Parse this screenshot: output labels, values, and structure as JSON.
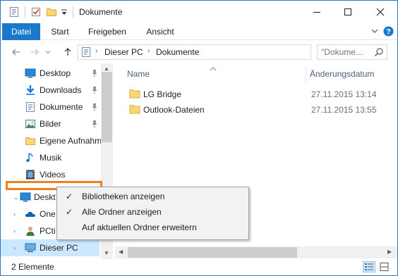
{
  "window": {
    "title": "Dokumente",
    "controls": [
      "minimize",
      "maximize",
      "close"
    ]
  },
  "quick_access_toolbar": {
    "icons": [
      "properties-icon",
      "checkmark-icon",
      "new-folder-icon",
      "customize-dropdown-icon"
    ]
  },
  "ribbon": {
    "tabs": [
      {
        "label": "Datei",
        "active": true
      },
      {
        "label": "Start"
      },
      {
        "label": "Freigeben"
      },
      {
        "label": "Ansicht"
      }
    ],
    "expand_icon": "chevron-down-icon",
    "help_icon": "help-icon",
    "accent": "#1979ca"
  },
  "address_bar": {
    "segments": [
      "Dieser PC",
      "Dokumente"
    ],
    "search_placeholder": "\"Dokume..."
  },
  "nav_pane": {
    "items": [
      {
        "label": "Desktop",
        "icon": "desktop-icon",
        "pinned": true
      },
      {
        "label": "Downloads",
        "icon": "downloads-icon",
        "pinned": true
      },
      {
        "label": "Dokumente",
        "icon": "documents-icon",
        "pinned": true
      },
      {
        "label": "Bilder",
        "icon": "pictures-icon",
        "pinned": true
      },
      {
        "label": "Eigene Aufnahm",
        "icon": "folder-icon",
        "pinned": false
      },
      {
        "label": "Musik",
        "icon": "music-icon",
        "pinned": false
      },
      {
        "label": "Videos",
        "icon": "videos-icon",
        "pinned": false
      },
      {
        "label": "Deskt",
        "icon": "desktop-icon",
        "expanded": true
      },
      {
        "label": "One",
        "icon": "onedrive-icon"
      },
      {
        "label": "PCti",
        "icon": "user-icon"
      },
      {
        "label": "Dieser PC",
        "icon": "computer-icon",
        "selected": true
      }
    ]
  },
  "file_list": {
    "columns": {
      "name": "Name",
      "modified": "Änderungsdatum"
    },
    "rows": [
      {
        "name": "LG Bridge",
        "modified": "27.11.2015 13:14"
      },
      {
        "name": "Outlook-Dateien",
        "modified": "27.11.2015 13:55"
      }
    ]
  },
  "context_menu": {
    "items": [
      {
        "label": "Bibliotheken anzeigen",
        "checked": true
      },
      {
        "label": "Alle Ordner anzeigen",
        "checked": true
      },
      {
        "label": "Auf aktuellen Ordner erweitern",
        "checked": false
      }
    ]
  },
  "status_bar": {
    "text": "2 Elemente"
  },
  "colors": {
    "highlight_annotation": "#f07f20",
    "selection": "#cce8ff",
    "folder": "#f8d775"
  }
}
